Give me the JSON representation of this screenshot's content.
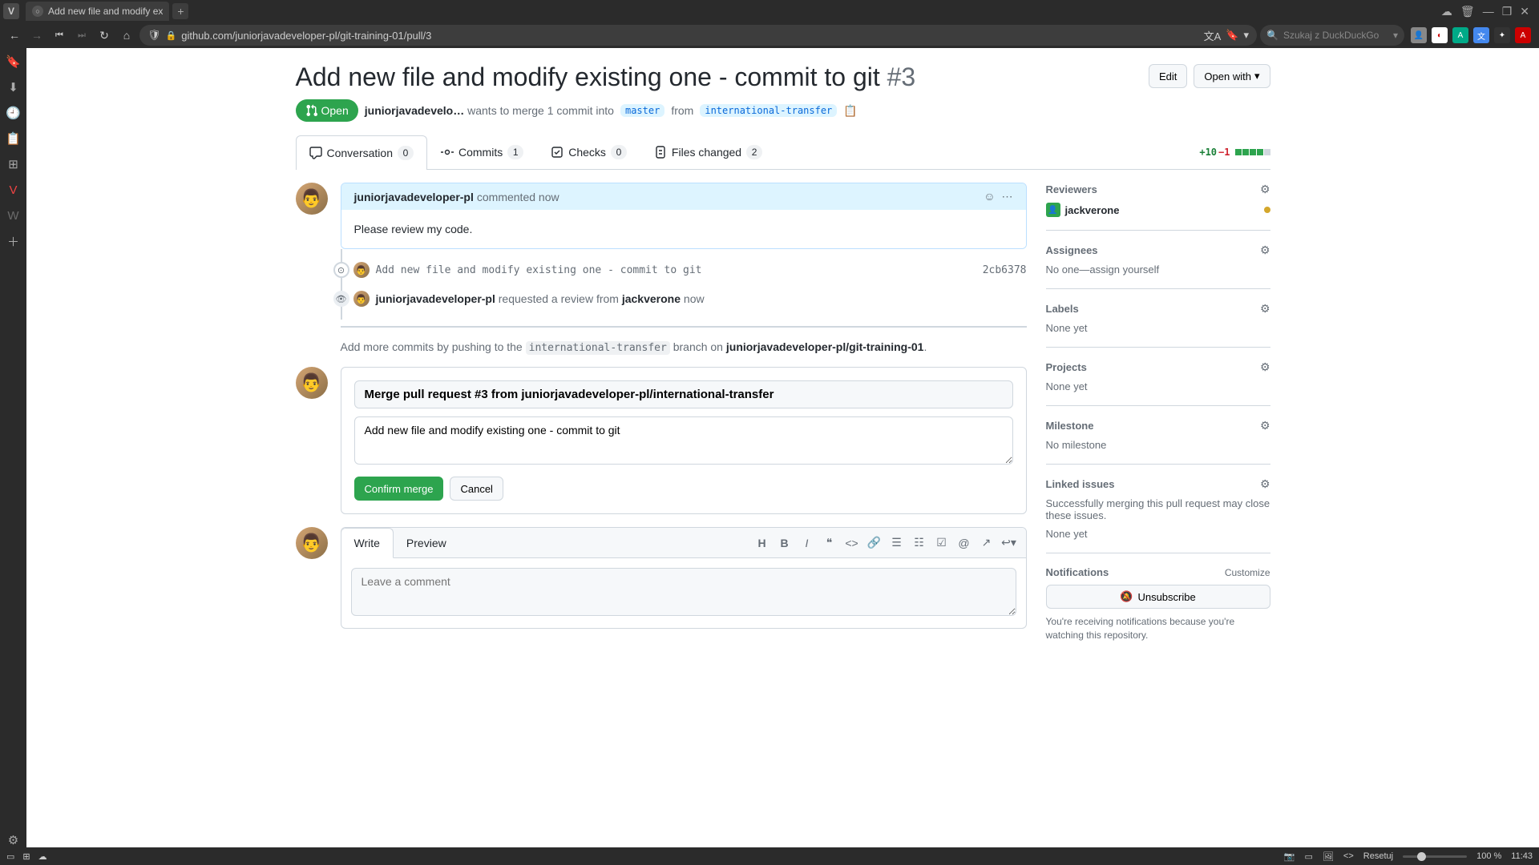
{
  "browser": {
    "tab_title": "Add new file and modify ex",
    "url": "github.com/juniorjavadeveloper-pl/git-training-01/pull/3",
    "search_placeholder": "Szukaj z DuckDuckGo",
    "status": {
      "reset": "Resetuj",
      "zoom": "100 %",
      "time": "11:43"
    }
  },
  "pr": {
    "title": "Add new file and modify existing one - commit to git",
    "number": "#3",
    "edit_btn": "Edit",
    "open_with_btn": "Open with",
    "state": "Open",
    "author": "juniorjavadevelo…",
    "merge_text_pre": "wants to merge 1 commit into",
    "base_branch": "master",
    "merge_text_mid": "from",
    "head_branch": "international-transfer"
  },
  "tabs": {
    "conversation": {
      "label": "Conversation",
      "count": "0"
    },
    "commits": {
      "label": "Commits",
      "count": "1"
    },
    "checks": {
      "label": "Checks",
      "count": "0"
    },
    "files": {
      "label": "Files changed",
      "count": "2"
    },
    "diff_add": "+10",
    "diff_del": "−1"
  },
  "comment": {
    "author": "juniorjavadeveloper-pl",
    "action": "commented",
    "when": "now",
    "body": "Please review my code."
  },
  "commit_event": {
    "message": "Add new file and modify existing one - commit to git",
    "sha": "2cb6378"
  },
  "review_event": {
    "actor": "juniorjavadeveloper-pl",
    "text_mid": "requested a review from",
    "reviewer": "jackverone",
    "when": "now"
  },
  "push_hint": {
    "pre": "Add more commits by pushing to the",
    "branch": "international-transfer",
    "mid": "branch on",
    "repo": "juniorjavadeveloper-pl/git-training-01"
  },
  "merge": {
    "title": "Merge pull request #3 from juniorjavadeveloper-pl/international-transfer",
    "body": "Add new file and modify existing one - commit to git",
    "confirm": "Confirm merge",
    "cancel": "Cancel"
  },
  "composer": {
    "write": "Write",
    "preview": "Preview",
    "placeholder": "Leave a comment"
  },
  "sidebar": {
    "reviewers": {
      "title": "Reviewers",
      "name": "jackverone"
    },
    "assignees": {
      "title": "Assignees",
      "content": "No one—assign yourself"
    },
    "labels": {
      "title": "Labels",
      "content": "None yet"
    },
    "projects": {
      "title": "Projects",
      "content": "None yet"
    },
    "milestone": {
      "title": "Milestone",
      "content": "No milestone"
    },
    "linked": {
      "title": "Linked issues",
      "desc": "Successfully merging this pull request may close these issues.",
      "content": "None yet"
    },
    "notifications": {
      "title": "Notifications",
      "customize": "Customize",
      "unsub": "Unsubscribe",
      "desc": "You're receiving notifications because you're watching this repository."
    }
  }
}
